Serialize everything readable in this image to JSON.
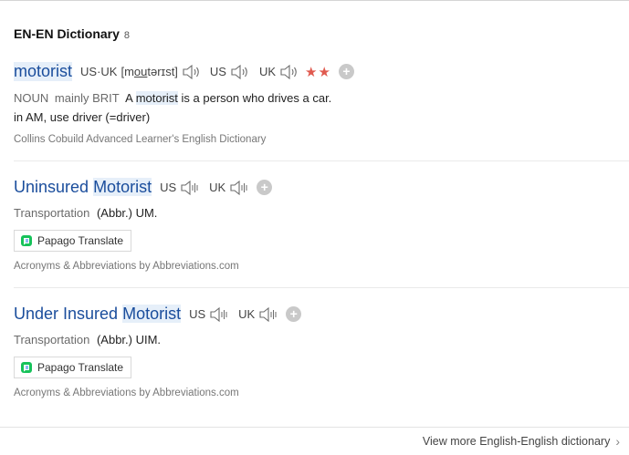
{
  "section": {
    "title": "EN-EN Dictionary",
    "count": "8"
  },
  "entry1": {
    "headword": "motorist",
    "variant_label": "US·UK",
    "ipa_pre": "[m",
    "ipa_ou": "ou",
    "ipa_post": "tərɪst]",
    "us_label": "US",
    "uk_label": "UK",
    "stars": "★★",
    "pos": "NOUN",
    "usage": "mainly BRIT",
    "def_a": "A",
    "def_hl": "motorist",
    "def_b": "is a person who drives a car.",
    "note": "in AM, use driver (=driver)",
    "source": "Collins Cobuild Advanced Learner's English Dictionary"
  },
  "entry2": {
    "head_a": "Uninsured",
    "head_hl": "Motorist",
    "us_label": "US",
    "uk_label": "UK",
    "category": "Transportation",
    "meaning": "(Abbr.) UM.",
    "button": "Papago Translate",
    "source": "Acronyms & Abbreviations by Abbreviations.com"
  },
  "entry3": {
    "head_a": "Under Insured",
    "head_hl": "Motorist",
    "us_label": "US",
    "uk_label": "UK",
    "category": "Transportation",
    "meaning": "(Abbr.) UIM.",
    "button": "Papago Translate",
    "source": "Acronyms & Abbreviations by Abbreviations.com"
  },
  "footer": {
    "more_link": "View more English-English dictionary"
  },
  "colors": {
    "headword": "#1a4d9c",
    "highlight": "#e6eff9",
    "stars": "#e05a4f"
  }
}
